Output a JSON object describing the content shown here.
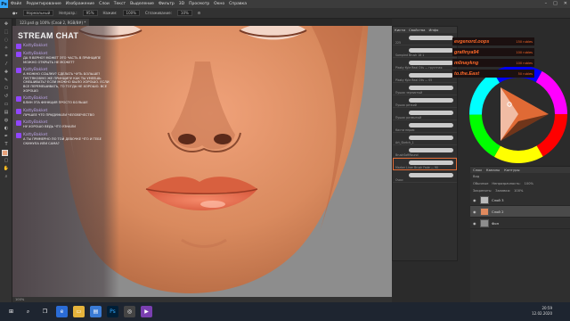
{
  "menu": {
    "logo": "Ps",
    "items": [
      "Файл",
      "Редактирование",
      "Изображение",
      "Слои",
      "Текст",
      "Выделение",
      "Фильтр",
      "3D",
      "Просмотр",
      "Окно",
      "Справка"
    ]
  },
  "options": {
    "mode": "Нормальный",
    "opacity_label": "Непрозр.:",
    "opacity": "95%",
    "flow_label": "Нажим:",
    "flow": "100%",
    "smoothing_label": "Сглаживание:",
    "smoothing": "10%"
  },
  "document_tab": "123.psd @ 100% (Слой 2, RGB/8#) *",
  "chat": {
    "title": "STREAM CHAT",
    "messages": [
      {
        "user": "KattyBakket",
        "text": ""
      },
      {
        "user": "KattyBakket",
        "text": "да я верно? может это часть в принципе можно открыть не может?"
      },
      {
        "user": "KattyBakket",
        "text": "а можно ссылку? сделать чуть больше? пустяковую же принципу как ты умеешь смешивать? если можно было хорошо. если все перемешивать, то тогда не хорошо. все хорошо"
      },
      {
        "user": "KattyBakket",
        "text": "блин эта функция просто больше"
      },
      {
        "user": "KattyBakket",
        "text": "лучшее что придумали человечество"
      },
      {
        "user": "KattyBakket",
        "text": "ну хорошо ведь что узнали"
      },
      {
        "user": "KattyBakket",
        "text": "а ты примерно по той девочке что и тебе скинула или сама?"
      }
    ]
  },
  "brushes_panel": {
    "tabs": [
      "Кисти",
      "Свойства",
      "Инфо"
    ],
    "items": [
      {
        "name": "225"
      },
      {
        "name": "Sampled Brush 18 1"
      },
      {
        "name": "Plasty Kyle Real Oils — грустная"
      },
      {
        "name": "Plasty Kyle Real Oils — 05"
      },
      {
        "name": "Пушок зернистый"
      },
      {
        "name": "Пушок резкий"
      },
      {
        "name": "Пушок размытый"
      },
      {
        "name": "Кисти пером"
      },
      {
        "name": "Art_Sketch_1"
      },
      {
        "name": "BrushSoftRound"
      },
      {
        "name": "Marker Liner Brush Fade — 90"
      },
      {
        "name": "Очки"
      }
    ]
  },
  "overlay": {
    "donations": [
      {
        "name": "evgenord.oops",
        "amount": "150 rubles"
      },
      {
        "name": "grafinya94",
        "amount": "100 rubles"
      },
      {
        "name": "m0naykng",
        "amount": "100 rubles"
      },
      {
        "name": "to.the.East",
        "amount": "50 rubles"
      }
    ]
  },
  "layers_panel": {
    "tabs": [
      "Слои",
      "Каналы",
      "Контуры"
    ],
    "kind": "Вид",
    "blend": "Обычные",
    "opacity_label": "Непрозрачность:",
    "opacity": "100%",
    "lock_label": "Закрепить:",
    "fill_label": "Заливка:",
    "fill": "100%",
    "layers": [
      {
        "name": "Слой 3",
        "active": false
      },
      {
        "name": "Слой 2",
        "active": true
      },
      {
        "name": "Фон",
        "active": false
      }
    ]
  },
  "status": "100%",
  "clock": {
    "time": "20:59",
    "date": "12.02.2020"
  },
  "colors": {
    "accent": "#e06a35",
    "twitch": "#9146ff"
  }
}
